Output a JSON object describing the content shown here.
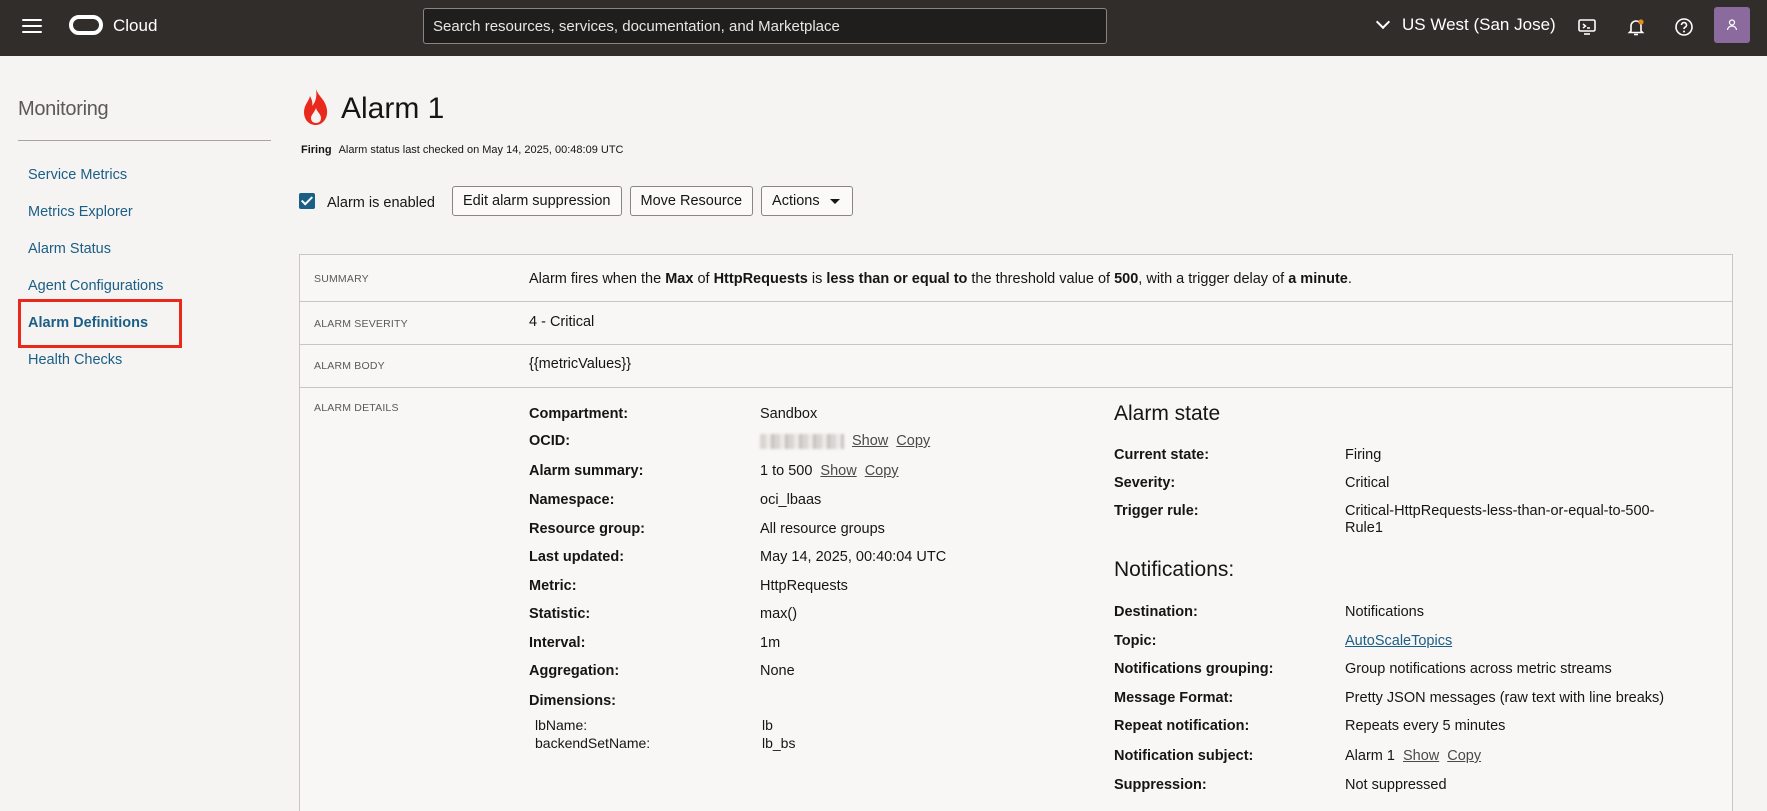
{
  "topbar": {
    "brand": "Cloud",
    "search_placeholder": "Search resources, services, documentation, and Marketplace",
    "region": "US West (San Jose)"
  },
  "sidebar": {
    "title": "Monitoring",
    "items": [
      {
        "label": "Service Metrics"
      },
      {
        "label": "Metrics Explorer"
      },
      {
        "label": "Alarm Status"
      },
      {
        "label": "Agent Configurations"
      },
      {
        "label": "Alarm Definitions"
      },
      {
        "label": "Health Checks"
      }
    ]
  },
  "header": {
    "title": "Alarm 1",
    "state": "Firing",
    "status_text": "Alarm status last checked on May 14, 2025, 00:48:09 UTC"
  },
  "toolbar": {
    "enabled_label": "Alarm is enabled",
    "suppression_button": "Edit alarm suppression",
    "move_button": "Move Resource",
    "actions_button": "Actions"
  },
  "summary": {
    "label": "SUMMARY",
    "parts": [
      "Alarm fires when the ",
      "Max",
      " of ",
      "HttpRequests",
      " is ",
      "less than or equal to",
      " the threshold value of ",
      "500",
      ", with a trigger delay of ",
      "a minute",
      "."
    ]
  },
  "severity": {
    "label": "ALARM SEVERITY",
    "value": "4 - Critical"
  },
  "body": {
    "label": "ALARM BODY",
    "value": "{{metricValues}}"
  },
  "details": {
    "label": "ALARM DETAILS",
    "compartment": {
      "label": "Compartment:",
      "value": "Sandbox"
    },
    "ocid": {
      "label": "OCID:"
    },
    "alarm_summary": {
      "label": "Alarm summary:",
      "value": "1 to 500"
    },
    "namespace": {
      "label": "Namespace:",
      "value": "oci_lbaas"
    },
    "resource_group": {
      "label": "Resource group:",
      "value": "All resource groups"
    },
    "last_updated": {
      "label": "Last updated:",
      "value": "May 14, 2025, 00:40:04 UTC"
    },
    "metric": {
      "label": "Metric:",
      "value": "HttpRequests"
    },
    "statistic": {
      "label": "Statistic:",
      "value": "max()"
    },
    "interval": {
      "label": "Interval:",
      "value": "1m"
    },
    "aggregation": {
      "label": "Aggregation:",
      "value": "None"
    },
    "dimensions": {
      "label": "Dimensions:",
      "items": [
        {
          "name": "lbName:",
          "value": "lb"
        },
        {
          "name": "backendSetName:",
          "value": "lb_bs"
        }
      ]
    },
    "show_label": "Show",
    "copy_label": "Copy"
  },
  "alarm_state": {
    "title": "Alarm state",
    "current_state": {
      "label": "Current state:",
      "value": "Firing"
    },
    "severity": {
      "label": "Severity:",
      "value": "Critical"
    },
    "trigger_rule": {
      "label": "Trigger rule:",
      "value_line1": "Critical-HttpRequests-less-than-or-equal-to-500-",
      "value_line2": "Rule1"
    }
  },
  "notifications": {
    "title": "Notifications:",
    "destination": {
      "label": "Destination:",
      "value": "Notifications"
    },
    "topic": {
      "label": "Topic:",
      "value": "AutoScaleTopics"
    },
    "grouping": {
      "label": "Notifications grouping:",
      "value": "Group notifications across metric streams"
    },
    "format": {
      "label": "Message Format:",
      "value": "Pretty JSON messages (raw text with line breaks)"
    },
    "repeat": {
      "label": "Repeat notification:",
      "value": "Repeats every 5 minutes"
    },
    "subject": {
      "label": "Notification subject:",
      "value": "Alarm 1"
    },
    "suppression": {
      "label": "Suppression:",
      "value": "Not suppressed"
    }
  },
  "colors": {
    "topbar": "#312d2a",
    "link": "#1b5e86",
    "highlight_box": "#e8291c",
    "fire_icon": "#e8291c"
  },
  "icons": [
    "menu-icon",
    "oracle-logo-icon",
    "chevron-down-icon",
    "cloud-shell-icon",
    "bell-icon",
    "help-icon",
    "user-icon",
    "fire-icon",
    "checkbox-checked-icon",
    "caret-down-icon"
  ]
}
